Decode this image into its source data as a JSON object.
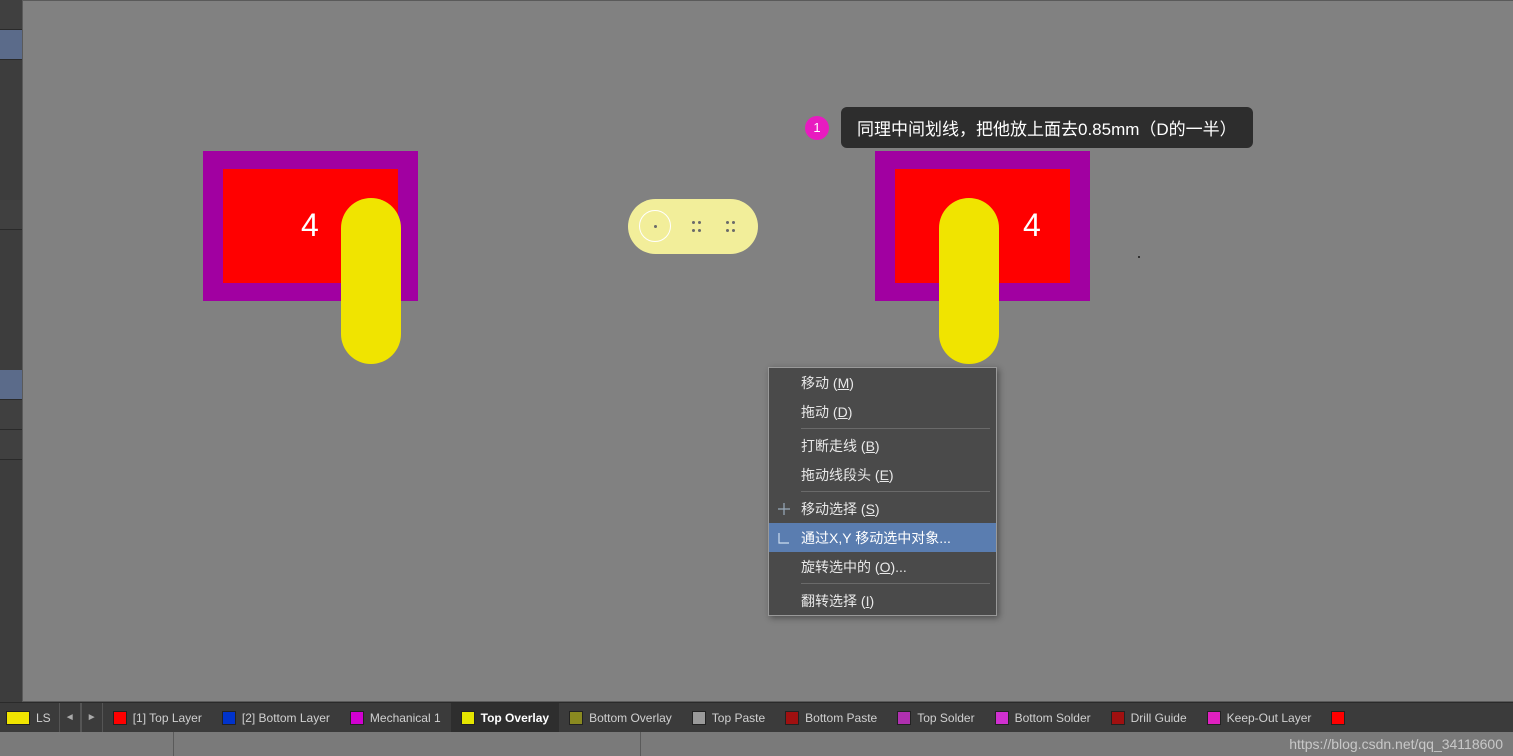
{
  "annotation": {
    "badge": "1",
    "text": "同理中间划线，把他放上面去0.85mm（D的一半）"
  },
  "pad_left": {
    "num": "4"
  },
  "pad_right": {
    "num": "4"
  },
  "context_menu": {
    "items": [
      {
        "label": "移动 (",
        "u": "M",
        "after": ")"
      },
      {
        "label": "拖动 (",
        "u": "D",
        "after": ")"
      },
      "sep",
      {
        "label": "打断走线 (",
        "u": "B",
        "after": ")"
      },
      {
        "label": "拖动线段头 (",
        "u": "E",
        "after": ")"
      },
      "sep",
      {
        "label": "移动选择 (",
        "u": "S",
        "after": ")",
        "icon": "plus"
      },
      {
        "label": "通过X,Y 移动选中对象...",
        "u": "",
        "after": "",
        "hover": true,
        "icon": "angle"
      },
      {
        "label": "旋转选中的 (",
        "u": "O",
        "after": ")..."
      },
      "sep",
      {
        "label": "翻转选择 (",
        "u": "I",
        "after": ")"
      }
    ]
  },
  "layer_bar": {
    "ls": "LS",
    "tabs": [
      {
        "label": "[1] Top Layer",
        "color": "#ff0000"
      },
      {
        "label": "[2] Bottom Layer",
        "color": "#0033cc"
      },
      {
        "label": "Mechanical 1",
        "color": "#d100d1"
      },
      {
        "label": "Top Overlay",
        "color": "#e5e500",
        "active": true
      },
      {
        "label": "Bottom Overlay",
        "color": "#8a8a20"
      },
      {
        "label": "Top Paste",
        "color": "#9a9a9a"
      },
      {
        "label": "Bottom Paste",
        "color": "#a01010"
      },
      {
        "label": "Top Solder",
        "color": "#b030b0"
      },
      {
        "label": "Bottom Solder",
        "color": "#d030d0"
      },
      {
        "label": "Drill Guide",
        "color": "#a01010"
      },
      {
        "label": "Keep-Out Layer",
        "color": "#e020c0"
      },
      {
        "label": "",
        "color": "#ff0000"
      }
    ]
  },
  "watermark": "https://blog.csdn.net/qq_34118600"
}
